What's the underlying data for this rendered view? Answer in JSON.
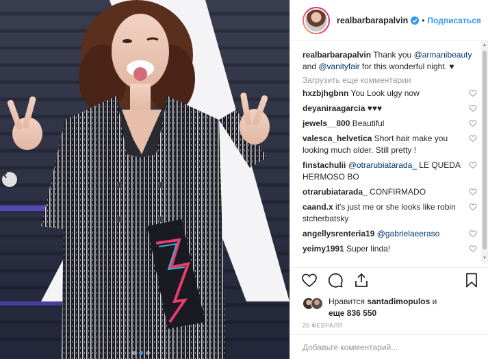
{
  "post": {
    "username": "realbarbarapalvin",
    "separator": "•",
    "follow_label": "Подписаться",
    "caption": {
      "username": "realbarbarapalvin",
      "text_before": "Thank you",
      "mention1": "@armanibeauty",
      "and_text": "and",
      "mention2": "@vanityfair",
      "text_after": "for this wonderful night. ♥"
    },
    "load_more_label": "Загрузить еще комментарии",
    "comments": [
      {
        "username": "hxzbjhgbnn",
        "mention": "",
        "text": "You Look ulgy now"
      },
      {
        "username": "deyaniraagarcia",
        "mention": "",
        "text": "♥♥♥"
      },
      {
        "username": "jewels__800",
        "mention": "",
        "text": "Beautiful"
      },
      {
        "username": "valesca_helvetica",
        "mention": "",
        "text": "Short hair make you looking much older. Still pretty !"
      },
      {
        "username": "finstachulii",
        "mention": "@otrarubiatarada_",
        "text": "LE QUEDA HERMOSO BO"
      },
      {
        "username": "otrarubiatarada_",
        "mention": "",
        "text": "CONFIRMADO"
      },
      {
        "username": "caand.x",
        "mention": "",
        "text": "it's just me or she looks like robin stcherbatsky"
      },
      {
        "username": "angellysrenteria19",
        "mention": "@gabrielaeeraso",
        "text": ""
      },
      {
        "username": "yeimy1991",
        "mention": "",
        "text": "Super linda!"
      }
    ],
    "likes": {
      "prefix": "Нравится",
      "user": "santadimopulos",
      "and_word": "и",
      "count_text": "еще 836 550"
    },
    "date": "26 ФЕВРАЛЯ",
    "add_comment_placeholder": "Добавьте комментарий...",
    "carousel": {
      "total": 3,
      "active": 2
    }
  },
  "icons": {
    "verified": "verified-badge-icon",
    "like": "heart-icon",
    "comment": "comment-bubble-icon",
    "share": "share-icon",
    "save": "bookmark-icon",
    "prev": "chevron-left-icon"
  },
  "colors": {
    "accent": "#3897f0",
    "mention": "#003569",
    "muted": "#999999",
    "text": "#262626"
  }
}
